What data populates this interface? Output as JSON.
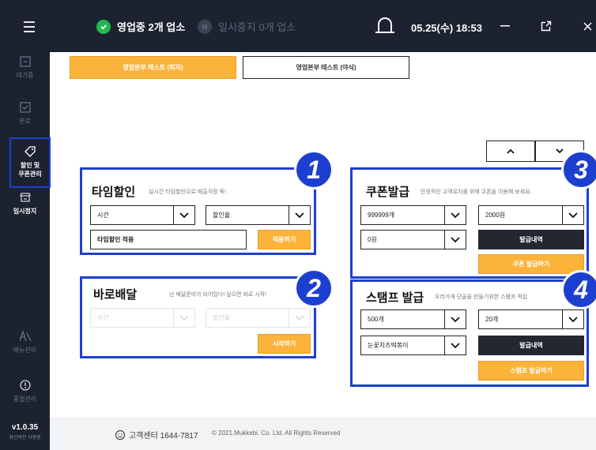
{
  "topbar": {
    "status_open": "영업중 2개 업소",
    "status_paused": "일시중지 0개 업소",
    "datetime": "05.25(수) 18:53"
  },
  "sidebar": {
    "items": [
      {
        "label": "대기중",
        "icon": "waiting-icon"
      },
      {
        "label": "완료",
        "icon": "check-icon"
      },
      {
        "label": "할인 및\n쿠폰관리",
        "icon": "tag-icon"
      },
      {
        "label": "임시정지",
        "icon": "store-icon"
      },
      {
        "label": "메뉴관리",
        "icon": "menu-book-icon"
      },
      {
        "label": "품절관리",
        "icon": "soldout-icon"
      }
    ],
    "version": "v1.0.35",
    "version_sub": "최신버전 사용중"
  },
  "tabs": {
    "active": "영업본부 테스트 (피자)",
    "inactive": "영업본부 테스트 (야식)"
  },
  "time_discount": {
    "badge": "1",
    "title": "타임할인",
    "desc": "실시간 타임할인으로 매출걱정 뚝!",
    "select_time": "시간",
    "select_rate": "할인율",
    "input_value": "타임할인 적용",
    "apply_label": "적용하기"
  },
  "instant_delivery": {
    "badge": "2",
    "title": "바로배달",
    "desc": "난 배달준비가 되어있다! 싶으면 바로 시작!",
    "select_time": "시간",
    "select_rate": "할인율",
    "start_label": "시작하기"
  },
  "coupon": {
    "badge": "3",
    "title": "쿠폰발급",
    "desc": "안정적인 고객유치를 위해 쿠폰을 이용해 보세요.",
    "select_count": "999999개",
    "select_amount": "2000원",
    "select_min": "0원",
    "history_label": "발급내역",
    "issue_label": "쿠폰 발급하기"
  },
  "stamp": {
    "badge": "4",
    "title": "스탬프 발급",
    "desc": "우리가게 단골을 만들기위한 스탬프 적립",
    "select_count": "500개",
    "select_goal": "20개",
    "select_menu": "눈꽃치즈떡볶이",
    "history_label": "발급내역",
    "issue_label": "스탬프 발급하기"
  },
  "footer": {
    "cs": "고객센터 1644-7817",
    "copyright": "© 2021.Mukkebi. Co. Ltd. All Rights Reserved"
  },
  "colors": {
    "accent": "#fcb33a",
    "frame": "#1d3fd0",
    "dark": "#1c2230"
  }
}
